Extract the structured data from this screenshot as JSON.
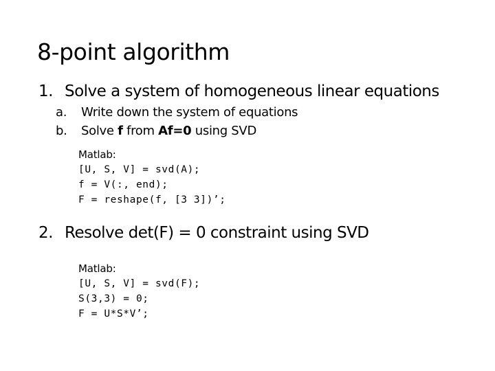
{
  "slide": {
    "title": "8-point algorithm",
    "items": [
      {
        "marker": "1.",
        "text": "Solve a system of homogeneous linear equations",
        "subitems": [
          {
            "marker": "a.",
            "text": "Write down the system of equations"
          },
          {
            "marker": "b.",
            "text_part1": "Solve ",
            "bold1": "f",
            "text_part2": " from  ",
            "bold2": "Af=0",
            "text_part3": " using SVD"
          }
        ],
        "code": {
          "label": "Matlab:",
          "lines": [
            "[U, S, V] = svd(A);",
            "f = V(:, end);",
            "F = reshape(f, [3 3])’;"
          ]
        }
      },
      {
        "marker": "2.",
        "text": "Resolve det(F) = 0 constraint using SVD",
        "code": {
          "label": "Matlab:",
          "lines": [
            "[U, S, V] = svd(F);",
            "S(3,3) = 0;",
            "F = U*S*V’;"
          ]
        }
      }
    ]
  },
  "colors": {
    "background": "#ffffff",
    "text": "#000000"
  }
}
